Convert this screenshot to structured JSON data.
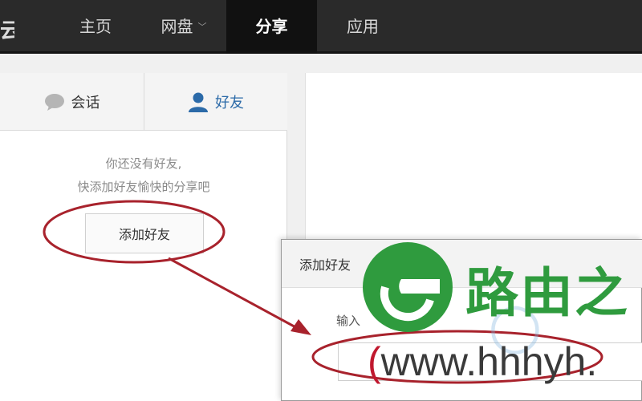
{
  "nav": {
    "brand_fragment": "云",
    "items": [
      {
        "label": "主页"
      },
      {
        "label": "网盘",
        "chevron": "﹀"
      },
      {
        "label": "分享"
      },
      {
        "label": "应用"
      }
    ],
    "active_index": 2
  },
  "left_panel": {
    "tabs": [
      {
        "label": "会话",
        "icon": "chat-bubble-icon"
      },
      {
        "label": "好友",
        "icon": "user-icon"
      }
    ],
    "active_tab": 1,
    "empty_line1": "你还没有好友,",
    "empty_line2": "快添加好友愉快的分享吧",
    "add_button_label": "添加好友"
  },
  "dialog": {
    "title": "添加好友",
    "input_label": "输入"
  },
  "watermark": {
    "logo_text": "路由之",
    "url_paren": "(",
    "url_text": "www.hhhyh."
  },
  "colors": {
    "nav_bg": "#2a2a2a",
    "active_tab_blue": "#2b6aa8",
    "annotation_red": "#a8222c",
    "watermark_green": "#2f9b3e"
  }
}
